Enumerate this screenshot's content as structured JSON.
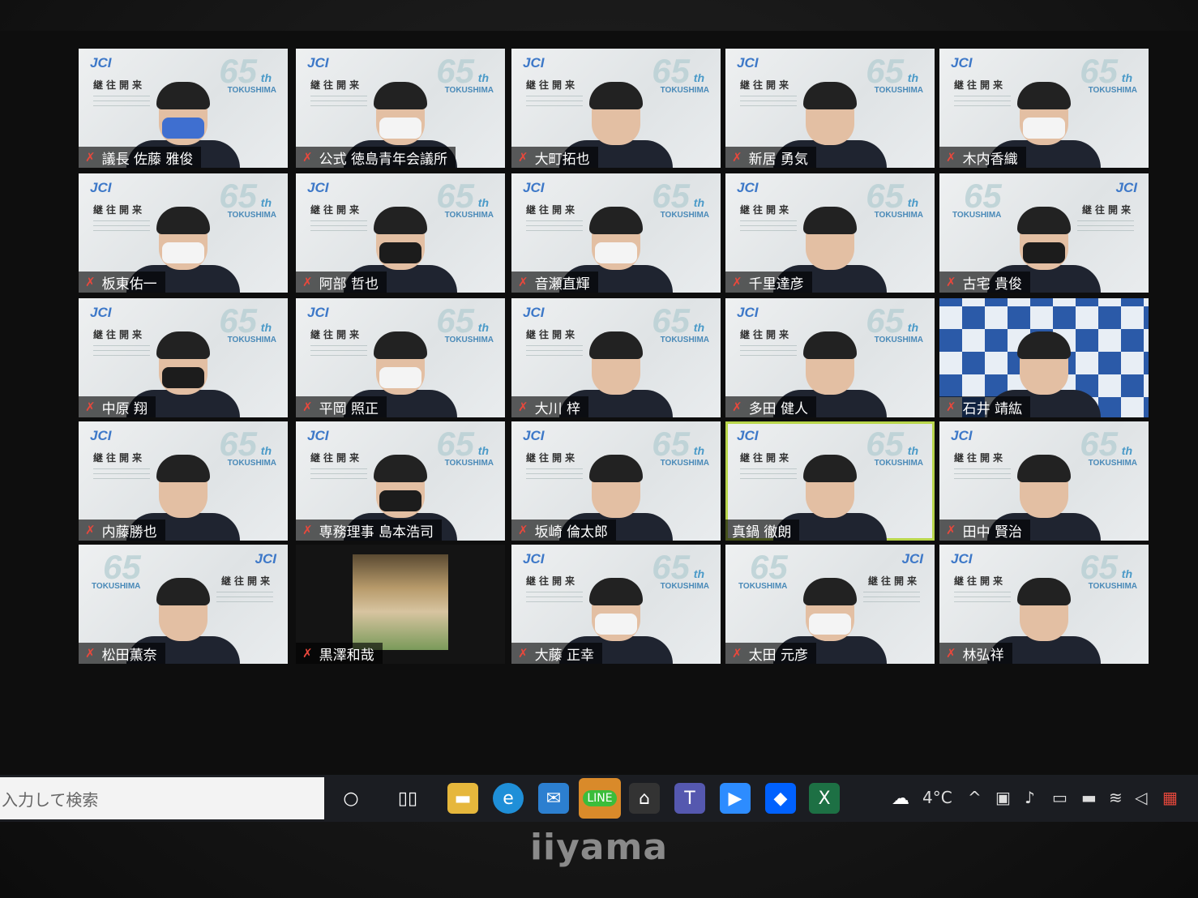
{
  "participants": [
    {
      "name": "議長 佐藤 雅俊",
      "style": "bg",
      "mask": "blue"
    },
    {
      "name": "公式 徳島青年会議所",
      "style": "bg",
      "mask": "white"
    },
    {
      "name": "大町拓也",
      "style": "bg",
      "mask": "none"
    },
    {
      "name": "新居 勇気",
      "style": "bg",
      "mask": "none"
    },
    {
      "name": "木内香織",
      "style": "bg",
      "mask": "white"
    },
    {
      "name": "板東佑一",
      "style": "bg",
      "mask": "white"
    },
    {
      "name": "阿部 哲也",
      "style": "bg",
      "mask": "black"
    },
    {
      "name": "音瀬直輝",
      "style": "bg-framed",
      "mask": "white"
    },
    {
      "name": "千里達彦",
      "style": "bg",
      "mask": "none"
    },
    {
      "name": "古宅 貴俊",
      "style": "bg-mirror",
      "mask": "black"
    },
    {
      "name": "中原 翔",
      "style": "bg",
      "mask": "black"
    },
    {
      "name": "平岡 照正",
      "style": "bg",
      "mask": "white"
    },
    {
      "name": "大川 梓",
      "style": "bg",
      "mask": "none"
    },
    {
      "name": "多田 健人",
      "style": "bg",
      "mask": "none"
    },
    {
      "name": "石井 靖紘",
      "style": "checker",
      "mask": "none"
    },
    {
      "name": "内藤勝也",
      "style": "bg",
      "mask": "none"
    },
    {
      "name": "専務理事 島本浩司",
      "style": "bg",
      "mask": "black"
    },
    {
      "name": "坂崎 倫太郎",
      "style": "bg",
      "mask": "none"
    },
    {
      "name": "真鍋 徹朗",
      "style": "speaking",
      "mask": "none"
    },
    {
      "name": "田中 賢治",
      "style": "bg",
      "mask": "none"
    },
    {
      "name": "松田薫奈",
      "style": "bg-mirror",
      "mask": "none"
    },
    {
      "name": "黒澤和哉",
      "style": "photo",
      "mask": "none"
    },
    {
      "name": "大藤 正幸",
      "style": "bg",
      "mask": "white"
    },
    {
      "name": "太田 元彦",
      "style": "bg-mirror",
      "mask": "white"
    },
    {
      "name": "林弘祥",
      "style": "bg",
      "mask": "none"
    }
  ],
  "background_text": {
    "logo": "JCI",
    "motto": "継往開来",
    "anniversary": "65",
    "anniversary_suffix": "th",
    "city": "TOKUSHIMA"
  },
  "taskbar": {
    "search_placeholder": "入力して検索",
    "weather": "4°C",
    "apps": [
      "cortana-icon",
      "task-view-icon",
      "file-explorer-icon",
      "edge-icon",
      "mail-icon",
      "line-icon",
      "reader-icon",
      "teams-icon",
      "zoom-icon",
      "dropbox-icon",
      "excel-icon"
    ]
  },
  "monitor_brand": "iiyama",
  "colors": {
    "speaking_border": "#b9d64b",
    "muted_mic": "#e8483c",
    "jci_blue": "#3d78c8"
  }
}
